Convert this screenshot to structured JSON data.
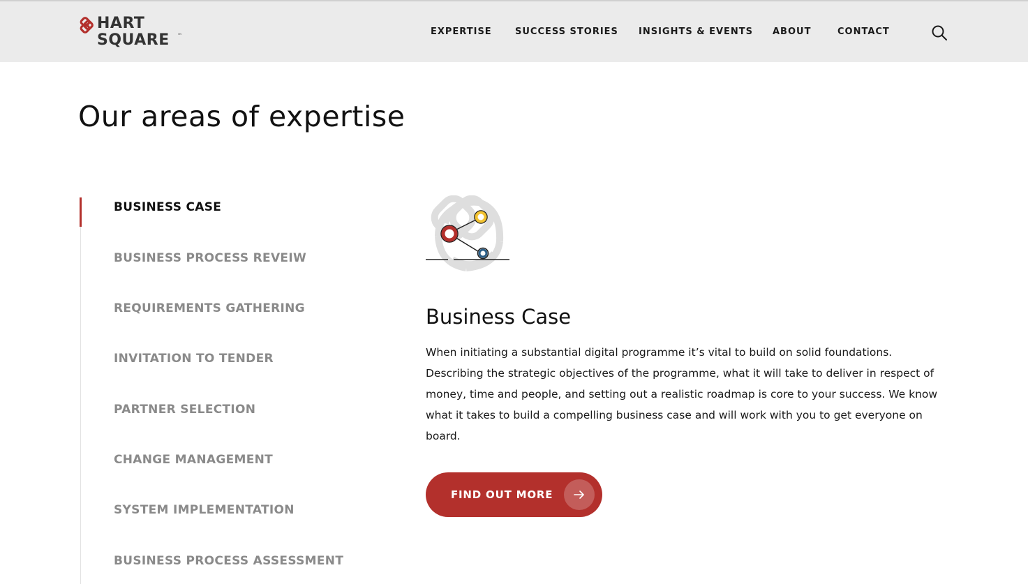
{
  "brand": {
    "line1": "HART",
    "line2": "SQUARE",
    "trademark": "™",
    "accent_color": "#b3302c"
  },
  "nav": {
    "items": [
      {
        "label": "EXPERTISE"
      },
      {
        "label": "SUCCESS STORIES"
      },
      {
        "label": "INSIGHTS & EVENTS"
      },
      {
        "label": "ABOUT"
      },
      {
        "label": "CONTACT"
      }
    ],
    "search_icon": "search-icon"
  },
  "page": {
    "title": "Our areas of expertise"
  },
  "sidebar": {
    "items": [
      {
        "label": "BUSINESS CASE",
        "active": true
      },
      {
        "label": "BUSINESS PROCESS REVEIW",
        "active": false
      },
      {
        "label": "REQUIREMENTS GATHERING",
        "active": false
      },
      {
        "label": "INVITATION TO TENDER",
        "active": false
      },
      {
        "label": "PARTNER SELECTION",
        "active": false
      },
      {
        "label": "CHANGE MANAGEMENT",
        "active": false
      },
      {
        "label": "SYSTEM IMPLEMENTATION",
        "active": false
      },
      {
        "label": "BUSINESS PROCESS ASSESSMENT",
        "active": false
      }
    ]
  },
  "detail": {
    "illustration_icon": "business-case-network-icon",
    "heading": "Business Case",
    "body": "When initiating a substantial digital programme it’s vital to build on solid foundations. Describing the strategic objectives of the programme, what it will take to deliver in respect of money, time and people, and setting out a realistic roadmap is core to your success. We know what it takes to build a compelling business case and will work with you to get everyone on board.",
    "cta_label": "FIND OUT MORE",
    "cta_icon": "arrow-right-icon"
  },
  "colors": {
    "header_bg": "#ebebeb",
    "node_red": "#b3302c",
    "node_yellow": "#f2c230",
    "node_blue": "#2a5d86",
    "inactive_text": "#8a8a8a"
  }
}
